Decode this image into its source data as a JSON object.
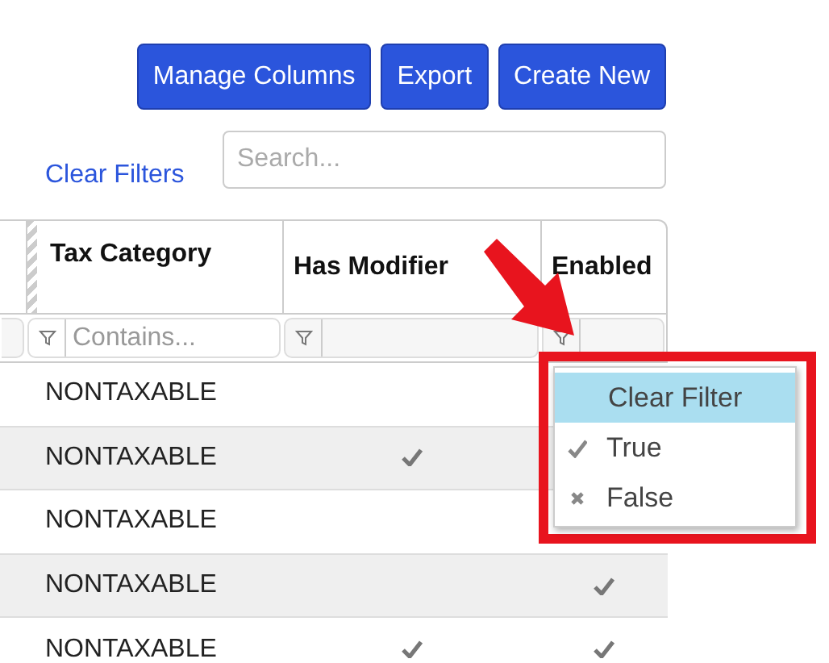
{
  "toolbar": {
    "buttons": [
      "Manage Columns",
      "Export",
      "Create New"
    ]
  },
  "clear_filters": "Clear Filters",
  "search": {
    "placeholder": "Search..."
  },
  "table": {
    "columns": [
      {
        "label": "Tax Category",
        "filter": {
          "kind": "text",
          "placeholder": "Contains..."
        }
      },
      {
        "label": "Has Modifier",
        "filter": {
          "kind": "boolean"
        }
      },
      {
        "label": "Enabled",
        "filter": {
          "kind": "boolean"
        }
      }
    ],
    "rows": [
      {
        "tax_category": "NONTAXABLE",
        "has_modifier": false
      },
      {
        "tax_category": "NONTAXABLE",
        "has_modifier": true
      },
      {
        "tax_category": "NONTAXABLE",
        "has_modifier": false
      },
      {
        "tax_category": "NONTAXABLE",
        "has_modifier": false,
        "enabled": true
      },
      {
        "tax_category": "NONTAXABLE",
        "has_modifier": true,
        "enabled": true
      }
    ]
  },
  "filter_menu": {
    "items": [
      {
        "label": "Clear Filter",
        "kind": "plain",
        "selected": true
      },
      {
        "label": "True",
        "kind": "check",
        "selected": false
      },
      {
        "label": "False",
        "kind": "cross",
        "selected": false
      }
    ]
  }
}
